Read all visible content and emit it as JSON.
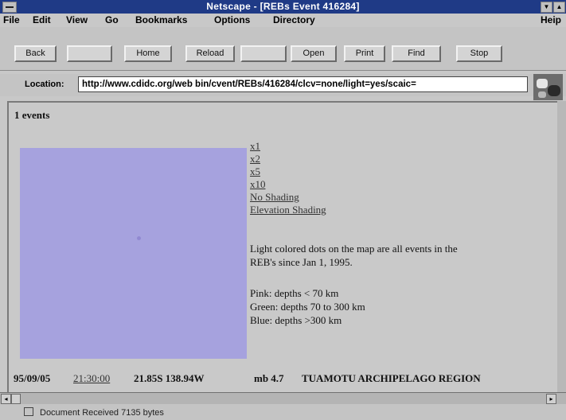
{
  "window": {
    "title": "Netscape - [REBs Event 416284]",
    "minimize_glyph": "▼",
    "restore_glyph": "▲"
  },
  "menu": {
    "file": "File",
    "edit": "Edit",
    "view": "View",
    "go": "Go",
    "bookmarks": "Bookmarks",
    "options": "Options",
    "directory": "Directory",
    "help": "Heip"
  },
  "toolbar": {
    "back": "Back",
    "forward": "",
    "home": "Home",
    "reload": "Reload",
    "images": "",
    "open": "Open",
    "print": "Print",
    "find": "Find",
    "stop": "Stop"
  },
  "location": {
    "label": "Location:",
    "url": "http://www.cdidc.org/web bin/cvent/REBs/416284/clcv=none/light=yes/scaic="
  },
  "page": {
    "events_count": "1 events",
    "zoom_links": [
      "x1",
      "x2",
      "x5",
      "x10"
    ],
    "shading_links": [
      "No Shading",
      "Elevation Shading"
    ],
    "description_line1": "Light colored dots on the map are all events in the",
    "description_line2": "REB's since Jan 1, 1995.",
    "legend_pink": "Pink: depths < 70 km",
    "legend_green": "Green: depths 70 to 300 km",
    "legend_blue": "Blue: depths >300 km",
    "event_date": "95/09/05",
    "event_time": "21:30:00",
    "event_coords": "21.85S 138.94W",
    "event_magnitude": "mb 4.7",
    "event_region": "TUAMOTU ARCHIPELAGO REGION"
  },
  "status": {
    "text": "Document Received 7135 bytes"
  },
  "icons": {
    "left_arrow": "◂",
    "right_arrow": "▸"
  }
}
